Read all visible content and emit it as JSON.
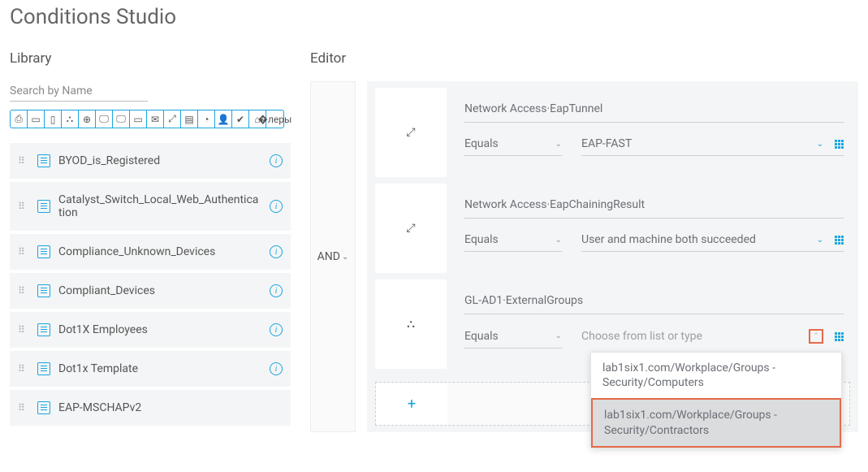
{
  "page_title": "Conditions Studio",
  "library": {
    "title": "Library",
    "search_placeholder": "Search by Name",
    "items": [
      {
        "name": "BYOD_is_Registered"
      },
      {
        "name": "Catalyst_Switch_Local_Web_Authentication"
      },
      {
        "name": "Compliance_Unknown_Devices"
      },
      {
        "name": "Compliant_Devices"
      },
      {
        "name": "Dot1X Employees"
      },
      {
        "name": "Dot1x Template"
      },
      {
        "name": "EAP-MSCHAPv2"
      }
    ]
  },
  "editor": {
    "title": "Editor",
    "logical_operator": "AND",
    "rules": [
      {
        "attribute": "Network Access·EapTunnel",
        "operator": "Equals",
        "value": "EAP-FAST"
      },
      {
        "attribute": "Network Access·EapChainingResult",
        "operator": "Equals",
        "value": "User and machine both succeeded"
      },
      {
        "attribute": "GL-AD1·ExternalGroups",
        "operator": "Equals",
        "value_placeholder": "Choose from list or type",
        "dropdown_options": [
          "lab1six1.com/Workplace/Groups - Security/Computers",
          "lab1six1.com/Workplace/Groups - Security/Contractors"
        ],
        "dropdown_selected_index": 1
      }
    ]
  }
}
